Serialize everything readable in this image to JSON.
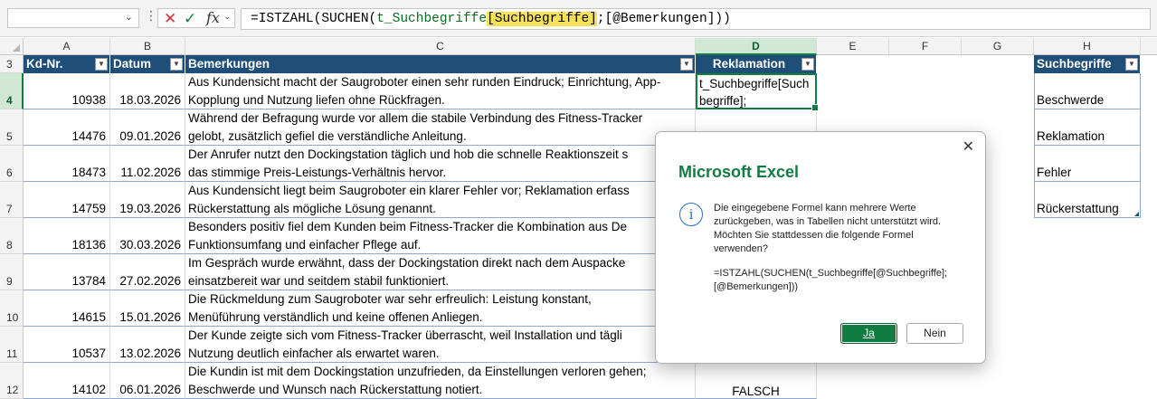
{
  "formula_bar": {
    "name_box": "",
    "cancel_glyph": "✕",
    "enter_glyph": "✓",
    "fx_label": "fx",
    "formula_prefix": "=ISTZAHL(SUCHEN(",
    "formula_ref1": "t_Suchbegriffe",
    "formula_hl": "[Suchbegriffe]",
    "formula_suffix": ";[@Bemerkungen]))"
  },
  "columns": [
    "A",
    "B",
    "C",
    "D",
    "E",
    "F",
    "G",
    "H"
  ],
  "rows": [
    "3",
    "4",
    "5",
    "6",
    "7",
    "8",
    "9",
    "10",
    "11",
    "12"
  ],
  "table_headers": {
    "kd": "Kd-Nr.",
    "datum": "Datum",
    "bemerkungen": "Bemerkungen",
    "reklamation": "Reklamation",
    "suchbegriffe": "Suchbegriffe"
  },
  "records": [
    {
      "kd": "10938",
      "datum": "18.03.2026",
      "l1": "Aus Kundensicht macht der Saugroboter einen sehr runden Eindruck; Einrichtung, App-",
      "l2": "Kopplung und Nutzung liefen ohne Rückfragen."
    },
    {
      "kd": "14476",
      "datum": "09.01.2026",
      "l1": "Während der Befragung wurde vor allem die stabile Verbindung des Fitness-Tracker",
      "l2": "gelobt, zusätzlich gefiel die verständliche Anleitung."
    },
    {
      "kd": "18473",
      "datum": "11.02.2026",
      "l1": "Der Anrufer nutzt den Dockingstation täglich und hob die schnelle Reaktionszeit s",
      "l2": "das stimmige Preis-Leistungs-Verhältnis hervor."
    },
    {
      "kd": "14759",
      "datum": "19.03.2026",
      "l1": "Aus Kundensicht liegt beim Saugroboter ein klarer Fehler vor; Reklamation erfass",
      "l2": "Rückerstattung als mögliche Lösung genannt."
    },
    {
      "kd": "18136",
      "datum": "30.03.2026",
      "l1": "Besonders positiv fiel dem Kunden beim Fitness-Tracker die Kombination aus De",
      "l2": "Funktionsumfang und einfacher Pflege auf."
    },
    {
      "kd": "13784",
      "datum": "27.02.2026",
      "l1": "Im Gespräch wurde erwähnt, dass der Dockingstation direkt nach dem Auspacke",
      "l2": "einsatzbereit war und seitdem stabil funktioniert."
    },
    {
      "kd": "14615",
      "datum": "15.01.2026",
      "l1": "Die Rückmeldung zum Saugroboter war sehr erfreulich: Leistung konstant,",
      "l2": "Menüführung verständlich und keine offenen Anliegen."
    },
    {
      "kd": "10537",
      "datum": "13.02.2026",
      "l1": "Der Kunde zeigte sich vom Fitness-Tracker überrascht, weil Installation und tägli",
      "l2": "Nutzung deutlich einfacher als erwartet waren."
    },
    {
      "kd": "14102",
      "datum": "06.01.2026",
      "l1": "Die Kundin ist mit dem Dockingstation unzufrieden, da Einstellungen verloren gehen;",
      "l2": "Beschwerde und Wunsch nach Rückerstattung notiert."
    }
  ],
  "active_cell": {
    "l1": "t_Suchbegriffe[Such",
    "l2": "begriffe];"
  },
  "d12_value": "FALSCH",
  "search_terms": [
    "Beschwerde",
    "Reklamation",
    "Fehler",
    "Rückerstattung"
  ],
  "dialog": {
    "title": "Microsoft Excel",
    "info_glyph": "i",
    "close_glyph": "✕",
    "msg_l1": "Die eingegebene Formel kann mehrere Werte",
    "msg_l2": "zurückgeben, was in Tabellen nicht unterstützt wird.",
    "msg_l3": "Möchten Sie stattdessen die folgende Formel",
    "msg_l4": "verwenden?",
    "formula_l1": "=ISTZAHL(SUCHEN(t_Suchbegriffe[@Suchbegriffe];",
    "formula_l2": "[@Bemerkungen]))",
    "yes": "Ja",
    "no": "Nein"
  },
  "colors": {
    "table_header": "#1f4e79",
    "accent": "#107c41",
    "formula_highlight": "#f8e15a"
  }
}
